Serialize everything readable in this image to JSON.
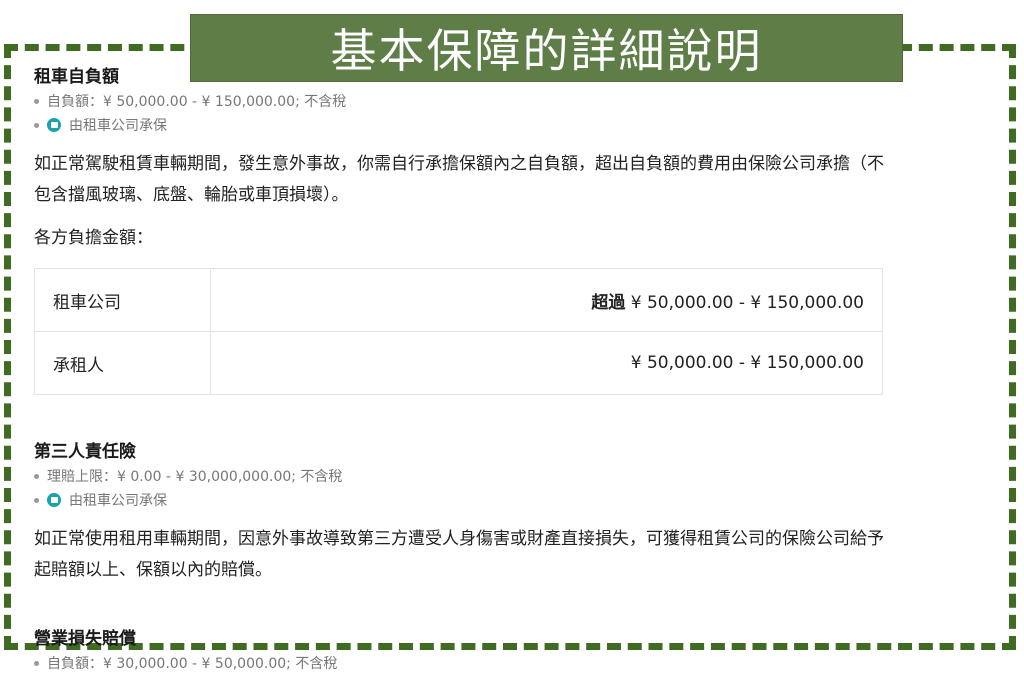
{
  "banner": {
    "title": "基本保障的詳細說明"
  },
  "sections": [
    {
      "title": "租車自負額",
      "meta_line": "自負額：¥ 50,000.00 - ¥ 150,000.00; 不含稅",
      "provider": "由租車公司承保",
      "description": "如正常駕駛租賃車輛期間，發生意外事故，你需自行承擔保額內之自負額，超出自負額的費用由保險公司承擔（不包含擋風玻璃、底盤、輪胎或車頂損壞）。",
      "subhead": "各方負擔金額：",
      "table": [
        {
          "party": "租車公司",
          "prefix": "超過",
          "amount": "¥ 50,000.00 - ¥ 150,000.00"
        },
        {
          "party": "承租人",
          "prefix": "",
          "amount": "¥ 50,000.00 - ¥ 150,000.00"
        }
      ]
    },
    {
      "title": "第三人責任險",
      "meta_line": "理賠上限：¥ 0.00 - ¥ 30,000,000.00; 不含稅",
      "provider": "由租車公司承保",
      "description": "如正常使用租用車輛期間，因意外事故導致第三方遭受人身傷害或財產直接損失，可獲得租賃公司的保險公司給予起賠額以上、保額以內的賠償。"
    },
    {
      "title": "營業損失賠償",
      "meta_line": "自負額：¥ 30,000.00 - ¥ 50,000.00; 不含稅"
    }
  ],
  "colors": {
    "frame": "#3f6b22",
    "banner_bg": "#5e7d47",
    "provider_icon": "#1aa3ad"
  }
}
